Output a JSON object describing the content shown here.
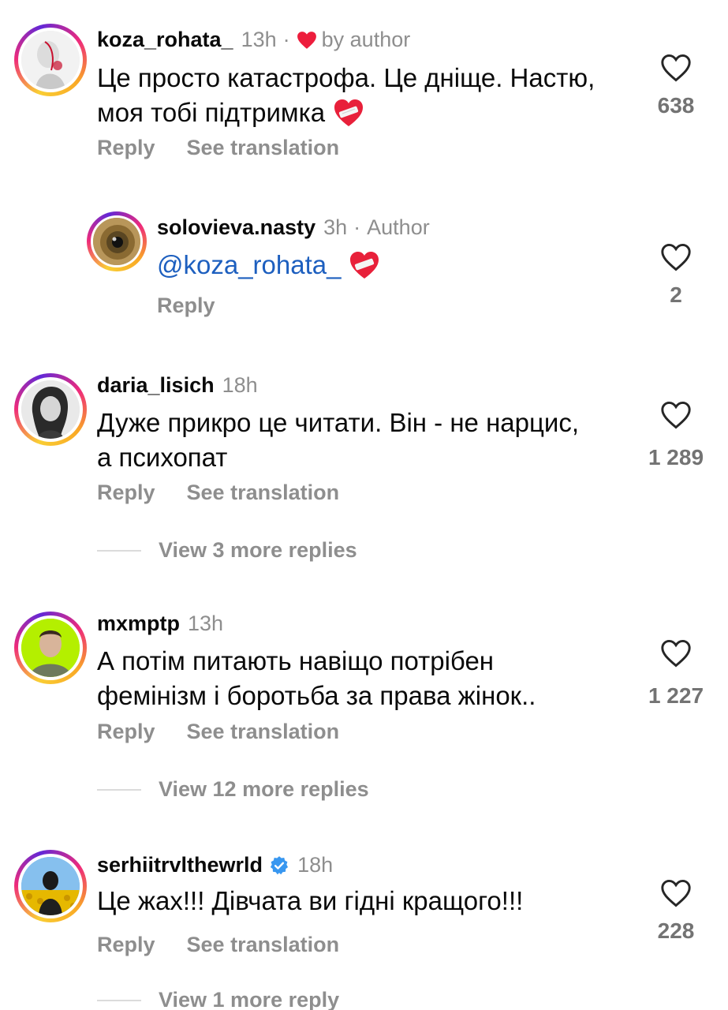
{
  "comments": [
    {
      "username": "koza_rohata_",
      "time": "13h",
      "by_author": "by author",
      "text_line1": "Це просто катастрофа. Це дніще. Настю,",
      "text_line2": "моя тобі підтримка",
      "reply": "Reply",
      "see_translation": "See translation",
      "likes": "638"
    },
    {
      "username": "solovieva.nasty",
      "time": "3h",
      "author_tag": "Author",
      "mention": "@koza_rohata_",
      "reply": "Reply",
      "likes": "2"
    },
    {
      "username": "daria_lisich",
      "time": "18h",
      "text_line1": "Дуже прикро це читати. Він - не нарцис,",
      "text_line2": "а психопат",
      "reply": "Reply",
      "see_translation": "See translation",
      "likes": "1 289",
      "view_more": "View 3 more replies"
    },
    {
      "username": "mxmptp",
      "time": "13h",
      "text_line1": "А потім питають навіщо потрібен",
      "text_line2": "фемінізм і боротьба за права жінок..",
      "reply": "Reply",
      "see_translation": "See translation",
      "likes": "1 227",
      "view_more": "View 12 more replies"
    },
    {
      "username": "serhiitrvlthewrld",
      "time": "18h",
      "text_line1": "Це жах!!! Дівчата ви гідні кращого!!!",
      "reply": "Reply",
      "see_translation": "See translation",
      "likes": "228",
      "view_more": "View 1 more reply"
    }
  ],
  "colors": {
    "muted": "#8e8e8e",
    "mention": "#1d5fbf",
    "author_heart": "#ed1d3c",
    "verified": "#3897f0"
  }
}
